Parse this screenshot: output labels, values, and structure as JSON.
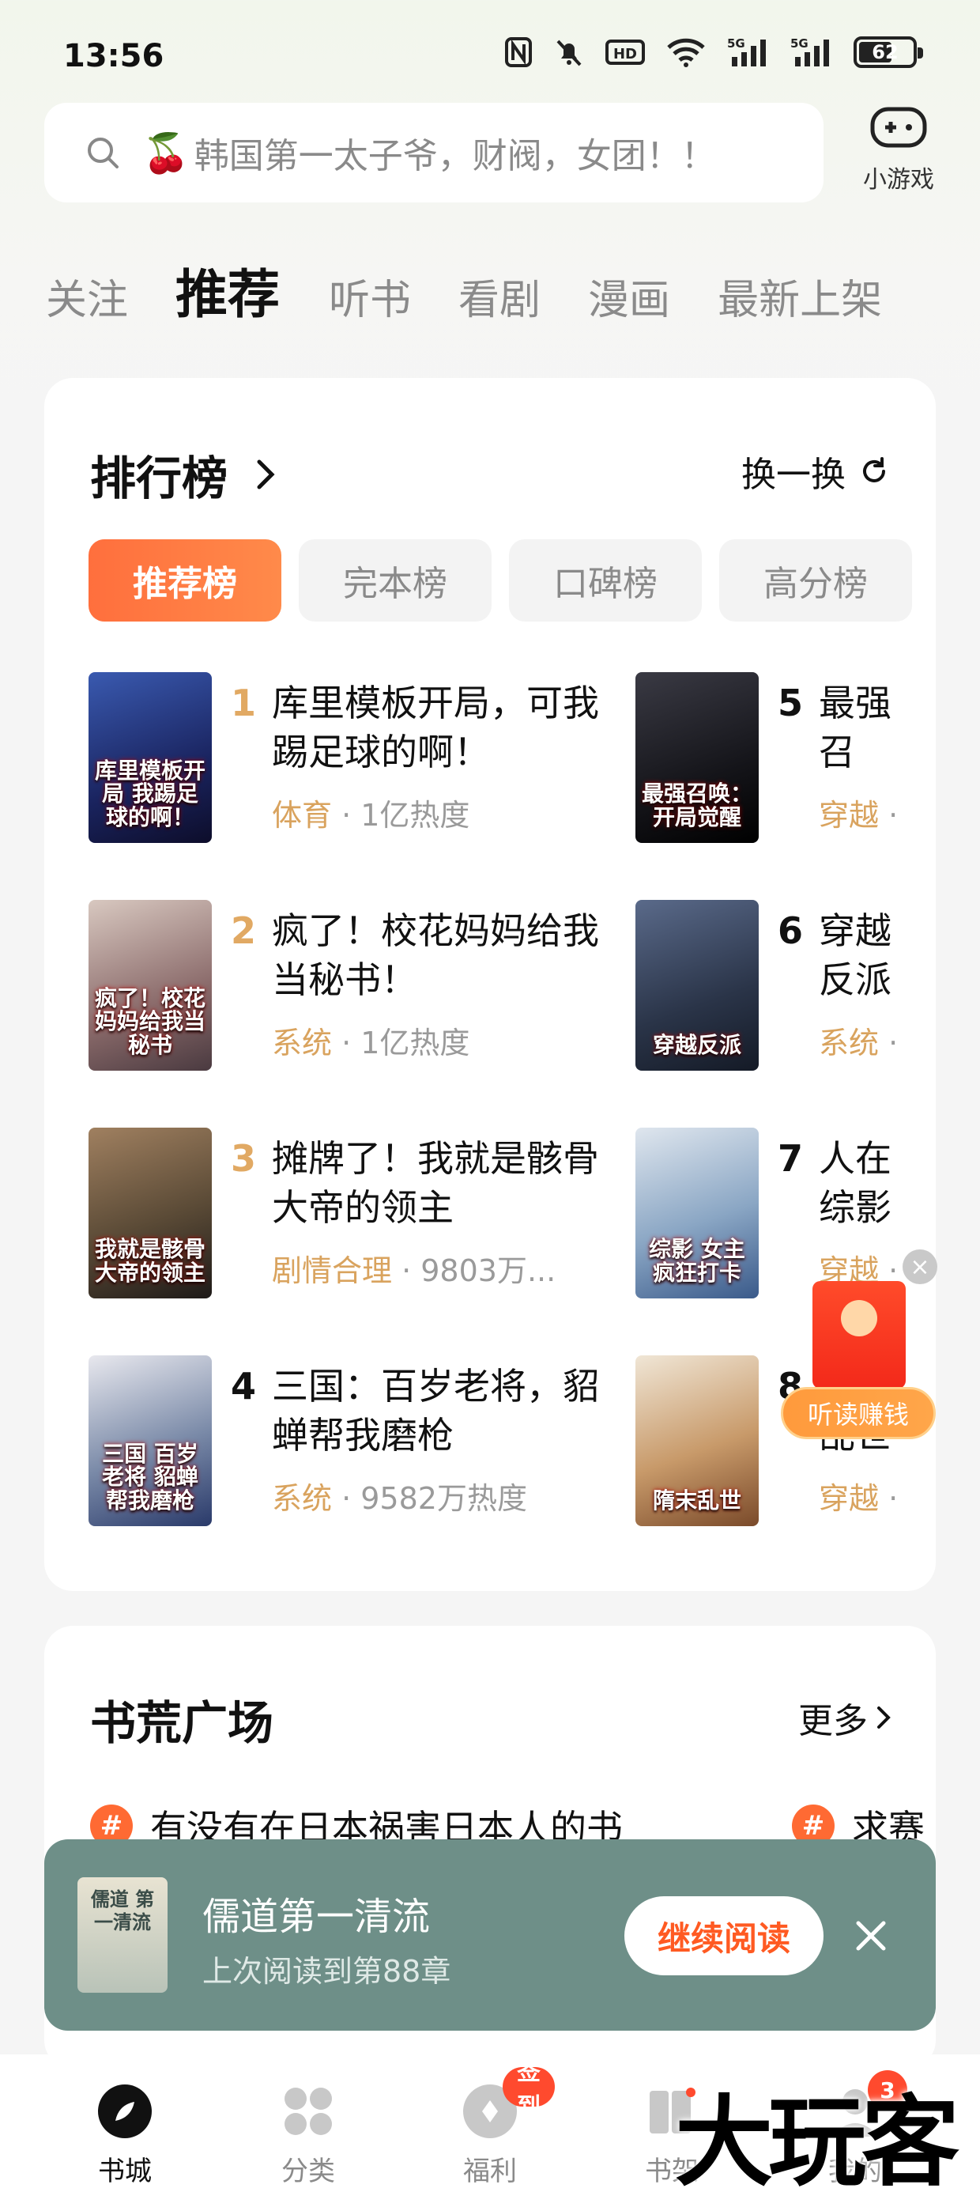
{
  "status_bar": {
    "time": "13:56",
    "battery": "62",
    "battery_level": 0.62,
    "network": "5G"
  },
  "search": {
    "emoji": "🍒",
    "placeholder": "韩国第一太子爷，财阀，女团！！"
  },
  "mini_game": {
    "label": "小游戏"
  },
  "top_tabs": [
    "关注",
    "推荐",
    "听书",
    "看剧",
    "漫画",
    "最新上架"
  ],
  "ranking": {
    "title": "排行榜",
    "refresh_label": "换一换",
    "pills": [
      "推荐榜",
      "完本榜",
      "口碑榜",
      "高分榜"
    ],
    "books": [
      {
        "rank": "1",
        "title": "库里模板开局，可我踢足球的啊！",
        "tag": "体育",
        "heat": " · 1亿热度",
        "cover_text": "库里模板开局 我踢足球的啊！",
        "cover_color": "#2a3f8a"
      },
      {
        "rank": "2",
        "title": "疯了！校花妈妈给我当秘书！",
        "tag": "系统",
        "heat": " · 1亿热度",
        "cover_text": "疯了！校花妈妈给我当秘书",
        "cover_color": "#7a5a5a"
      },
      {
        "rank": "3",
        "title": "摊牌了！我就是骸骨大帝的领主",
        "tag": "剧情合理",
        "heat": " · 9803万...",
        "cover_text": "我就是骸骨大帝的领主",
        "cover_color": "#5a4a36"
      },
      {
        "rank": "4",
        "title": "三国：百岁老将，貂蝉帮我磨枪",
        "tag": "系统",
        "heat": " · 9582万热度",
        "cover_text": "三国 百岁老将 貂蝉帮我磨枪",
        "cover_color": "#4a5a7a"
      },
      {
        "rank": "5",
        "title": "最强召唤：开局觉醒蓝色",
        "tag": "穿越",
        "heat": " · ",
        "cover_text": "最强召唤：开局觉醒",
        "cover_color": "#1e1e24"
      },
      {
        "rank": "6",
        "title": "穿越反派徒，卟",
        "tag": "系统",
        "heat": " · ",
        "cover_text": "穿越反派",
        "cover_color": "#3a4e6a"
      },
      {
        "rank": "7",
        "title": "人在综影女主疯",
        "tag": "穿越",
        "heat": " · ",
        "cover_text": "综影 女主疯狂打卡",
        "cover_color": "#6a8aa8"
      },
      {
        "rank": "8",
        "title": "隋末乱世光家",
        "tag": "穿越",
        "heat": " · ",
        "cover_text": "隋末乱世",
        "cover_color": "#a87a4a"
      }
    ]
  },
  "listen_float": {
    "label": "听读赚钱"
  },
  "plaza": {
    "title": "书荒广场",
    "more": "更多",
    "topics": [
      "有没有在日本祸害日本人的书",
      "求赛"
    ]
  },
  "continue_reading": {
    "title": "儒道第一清流",
    "subtitle": "上次阅读到第88章",
    "button": "继续阅读",
    "cover_text": "儒道 第一清流"
  },
  "bottom_nav": {
    "items": [
      {
        "label": "书城",
        "active": true
      },
      {
        "label": "分类",
        "active": false
      },
      {
        "label": "福利",
        "active": false,
        "badge": "签到"
      },
      {
        "label": "书架",
        "active": false
      },
      {
        "label": "我的",
        "active": false,
        "badge": "3"
      }
    ]
  },
  "watermark": "大玩客"
}
